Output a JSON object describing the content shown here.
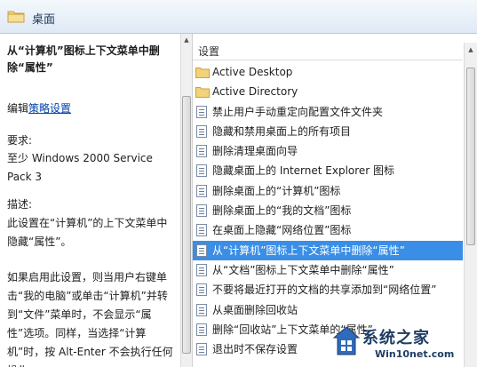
{
  "header": {
    "title": "桌面"
  },
  "description": {
    "title": "从“计算机”图标上下文菜单中删除“属性”",
    "edit_prefix": "编辑",
    "edit_link": "策略设置",
    "requirements_label": "要求:",
    "requirements_value": "至少 Windows 2000 Service Pack 3",
    "desc_label": "描述:",
    "desc_value": "此设置在“计算机”的上下文菜单中隐藏“属性”。",
    "detail": "如果启用此设置，则当用户右键单击“我的电脑”或单击“计算机”并转到“文件”菜单时，不会显示“属性”选项。同样，当选择“计算机”时，按 Alt-Enter 不会执行任何操作。"
  },
  "list": {
    "column_header": "设置",
    "items": [
      {
        "label": "Active Desktop",
        "type": "folder"
      },
      {
        "label": "Active Directory",
        "type": "folder"
      },
      {
        "label": "禁止用户手动重定向配置文件文件夹",
        "type": "policy"
      },
      {
        "label": "隐藏和禁用桌面上的所有项目",
        "type": "policy"
      },
      {
        "label": "删除清理桌面向导",
        "type": "policy"
      },
      {
        "label": "隐藏桌面上的 Internet Explorer 图标",
        "type": "policy"
      },
      {
        "label": "删除桌面上的“计算机”图标",
        "type": "policy"
      },
      {
        "label": "删除桌面上的“我的文档”图标",
        "type": "policy"
      },
      {
        "label": "在桌面上隐藏“网络位置”图标",
        "type": "policy"
      },
      {
        "label": "从“计算机”图标上下文菜单中删除“属性”",
        "type": "policy",
        "selected": true
      },
      {
        "label": "从“文档”图标上下文菜单中删除“属性”",
        "type": "policy"
      },
      {
        "label": "不要将最近打开的文档的共享添加到“网络位置”",
        "type": "policy"
      },
      {
        "label": "从桌面删除回收站",
        "type": "policy"
      },
      {
        "label": "删除“回收站”上下文菜单的“属性”",
        "type": "policy"
      },
      {
        "label": "退出时不保存设置",
        "type": "policy"
      }
    ]
  },
  "watermark": {
    "brand": "系统之家",
    "site": "Win10net.com"
  },
  "colors": {
    "selection": "#3a8ee6",
    "link": "#0044aa",
    "header_text": "#1e395b"
  }
}
